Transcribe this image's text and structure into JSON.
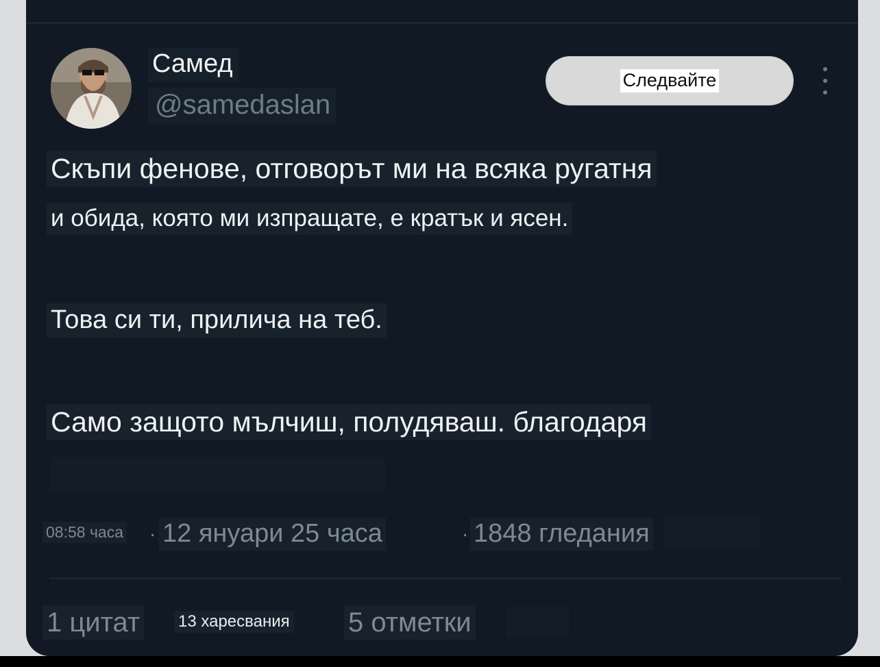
{
  "user": {
    "name": "Самед",
    "handle": "@samedaslan"
  },
  "actions": {
    "follow_label": "Следвайте"
  },
  "post": {
    "line1": "Скъпи фенове, отговорът ми на всяка ругатня",
    "line2": "и обида, която ми изпращате, е кратък и ясен.",
    "line3": "Това си ти, прилича на теб.",
    "line4": "Само защото мълчиш, полудяваш. благодаря"
  },
  "meta": {
    "time": "08:58 часа",
    "date": "12 януари 25 часа",
    "views": "1848 гледания",
    "separator": "·"
  },
  "stats": {
    "quotes": "1 цитат",
    "likes": "13 харесвания",
    "bookmarks": "5 отметки"
  },
  "colors": {
    "card_background": "#111a24",
    "text_primary": "#eef1f4",
    "text_secondary": "#7e8995",
    "follow_button": "#d9d9d9"
  }
}
